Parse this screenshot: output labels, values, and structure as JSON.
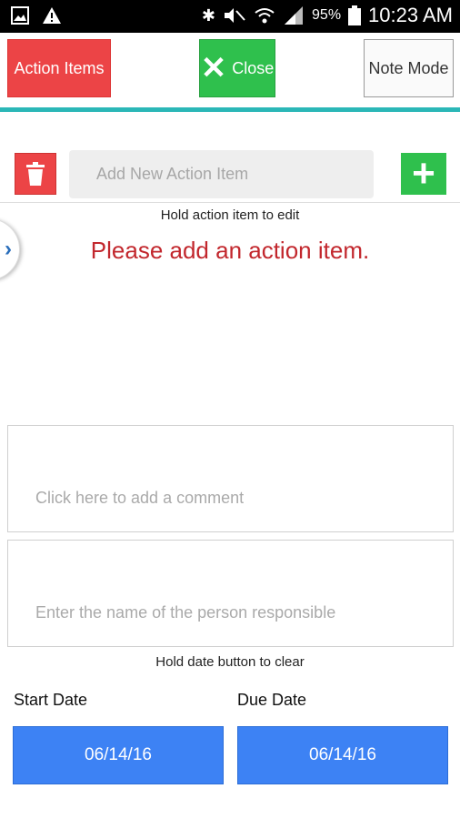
{
  "status_bar": {
    "battery_pct": "95%",
    "time": "10:23 AM",
    "left_icons": [
      "image-icon",
      "warning-icon"
    ],
    "right_icons": [
      "bluetooth-icon",
      "mute-icon",
      "wifi-icon",
      "signal-icon",
      "battery-icon"
    ]
  },
  "toolbar": {
    "action_items_label": "Action Items",
    "close_label": "Close",
    "note_mode_label": "Note Mode",
    "accent_color": "#2bb7b7"
  },
  "action_entry": {
    "placeholder": "Add New Action Item",
    "hold_hint": "Hold action item to edit",
    "empty_message": "Please add an action item."
  },
  "comment": {
    "placeholder": "Click here to add a comment"
  },
  "responsible": {
    "placeholder": "Enter the name of the person responsible"
  },
  "dates": {
    "hint": "Hold date button to clear",
    "start_label": "Start Date",
    "start_value": "06/14/16",
    "due_label": "Due Date",
    "due_value": "06/14/16"
  },
  "colors": {
    "red": "#ec4446",
    "green": "#2fc04d",
    "blue": "#3d82f4",
    "message_red": "#c2272d"
  }
}
